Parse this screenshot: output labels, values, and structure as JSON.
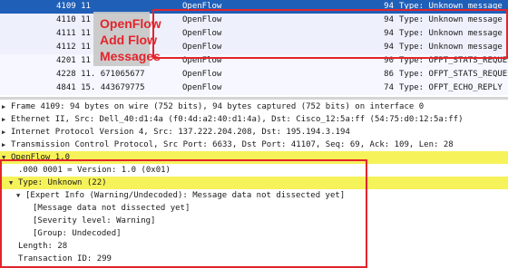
{
  "overlay_label": [
    "OpenFlow",
    "Add Flow",
    "Messages"
  ],
  "packets": [
    {
      "no": "4109 11",
      "proto": "OpenFlow",
      "len": "94",
      "info": "Type: Unknown message type",
      "style": "sel"
    },
    {
      "no": "4110 11",
      "proto": "OpenFlow",
      "len": "94",
      "info": "Type: Unknown message type",
      "style": "alt"
    },
    {
      "no": "4111 11",
      "proto": "OpenFlow",
      "len": "94",
      "info": "Type: Unknown message type",
      "style": "alt"
    },
    {
      "no": "4112 11",
      "proto": "OpenFlow",
      "len": "94",
      "info": "Type: Unknown message type",
      "style": "alt"
    },
    {
      "no": "4201 11",
      "proto": "OpenFlow",
      "len": "90",
      "info": "Type: OFPT_STATS_REQUEST",
      "style": "norm"
    },
    {
      "no": "4228 11. 671065677",
      "proto": "OpenFlow",
      "len": "86",
      "info": "Type: OFPT_STATS_REQUEST",
      "style": "norm"
    },
    {
      "no": "4841 15. 443679775",
      "proto": "OpenFlow",
      "len": "74",
      "info": "Type: OFPT_ECHO_REPLY",
      "style": "norm"
    }
  ],
  "details": [
    {
      "arrow": "▶",
      "text": "Frame 4109: 94 bytes on wire (752 bits), 94 bytes captured (752 bits) on interface 0",
      "indent": 0,
      "hl": false
    },
    {
      "arrow": "▶",
      "text": "Ethernet II, Src: Dell_40:d1:4a (f0:4d:a2:40:d1:4a), Dst: Cisco_12:5a:ff (54:75:d0:12:5a:ff)",
      "indent": 0,
      "hl": false
    },
    {
      "arrow": "▶",
      "text": "Internet Protocol Version 4, Src: 137.222.204.208, Dst: 195.194.3.194",
      "indent": 0,
      "hl": false
    },
    {
      "arrow": "▶",
      "text": "Transmission Control Protocol, Src Port: 6633, Dst Port: 41107, Seq: 69, Ack: 109, Len: 28",
      "indent": 0,
      "hl": false
    },
    {
      "arrow": "▼",
      "text": "OpenFlow 1.0",
      "indent": 0,
      "hl": true
    },
    {
      "arrow": "",
      "text": ".000 0001 = Version: 1.0 (0x01)",
      "indent": 1,
      "hl": false
    },
    {
      "arrow": "▼",
      "text": "Type: Unknown (22)",
      "indent": 1,
      "hl": true
    },
    {
      "arrow": "▼",
      "text": "[Expert Info (Warning/Undecoded): Message data not dissected yet]",
      "indent": 2,
      "hl": false
    },
    {
      "arrow": "",
      "text": "[Message data not dissected yet]",
      "indent": 3,
      "hl": false
    },
    {
      "arrow": "",
      "text": "[Severity level: Warning]",
      "indent": 3,
      "hl": false
    },
    {
      "arrow": "",
      "text": "[Group: Undecoded]",
      "indent": 3,
      "hl": false
    },
    {
      "arrow": "",
      "text": "Length: 28",
      "indent": 1,
      "hl": false
    },
    {
      "arrow": "",
      "text": "Transaction ID: 299",
      "indent": 1,
      "hl": false
    }
  ]
}
